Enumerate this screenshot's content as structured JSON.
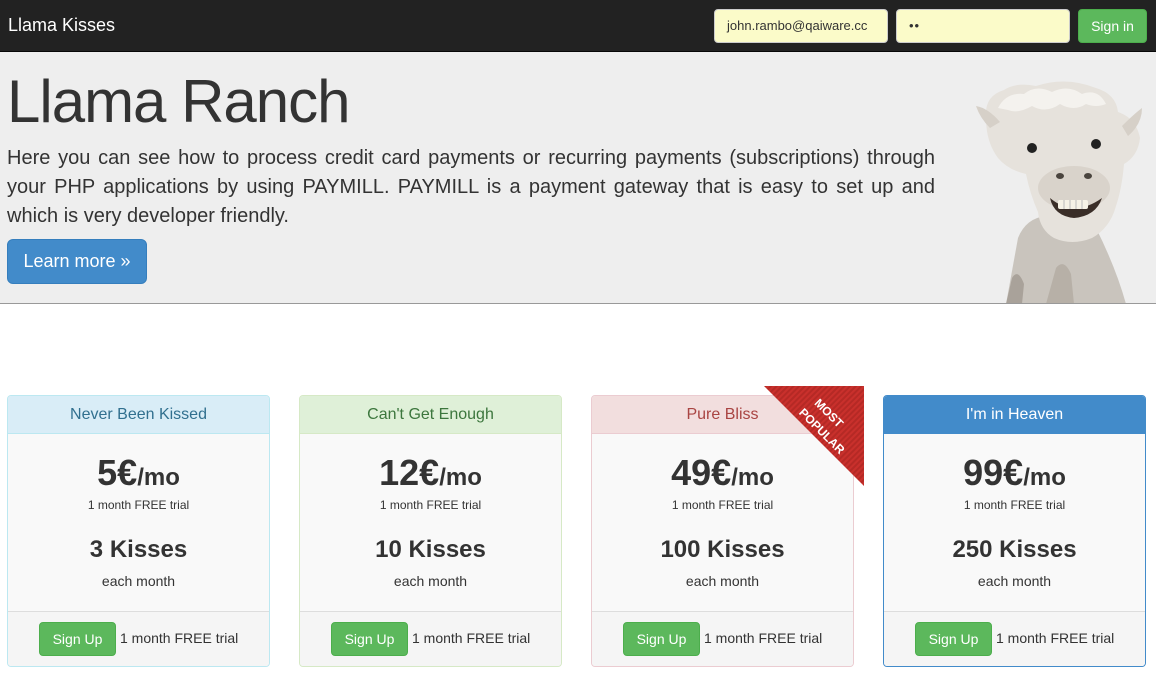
{
  "navbar": {
    "brand": "Llama Kisses",
    "email_value": "john.rambo@qaiware.cc",
    "password_value": "••",
    "signin_label": "Sign in"
  },
  "jumbotron": {
    "title": "Llama Ranch",
    "text": "Here you can see how to process credit card payments or recurring payments (subscriptions) through your PHP applications by using PAYMILL. PAYMILL is a payment gateway that is easy to set up and which is very developer friendly.",
    "button_label": "Learn more »"
  },
  "ribbon": {
    "line1": "MOST",
    "line2": "POPULAR",
    "color": "#c9302c"
  },
  "plans": [
    {
      "name": "Never Been Kissed",
      "price": "5€",
      "per": "/mo",
      "trial": "1 month FREE trial",
      "kisses": "3 Kisses",
      "each": "each month",
      "button": "Sign Up",
      "foot_trial": "1 month FREE trial"
    },
    {
      "name": "Can't Get Enough",
      "price": "12€",
      "per": "/mo",
      "trial": "1 month FREE trial",
      "kisses": "10 Kisses",
      "each": "each month",
      "button": "Sign Up",
      "foot_trial": "1 month FREE trial"
    },
    {
      "name": "Pure Bliss",
      "price": "49€",
      "per": "/mo",
      "trial": "1 month FREE trial",
      "kisses": "100 Kisses",
      "each": "each month",
      "button": "Sign Up",
      "foot_trial": "1 month FREE trial"
    },
    {
      "name": "I'm in Heaven",
      "price": "99€",
      "per": "/mo",
      "trial": "1 month FREE trial",
      "kisses": "250 Kisses",
      "each": "each month",
      "button": "Sign Up",
      "foot_trial": "1 month FREE trial"
    }
  ],
  "colors": {
    "navbar": "#222222",
    "primary": "#428bca",
    "success": "#5cb85c",
    "jumbotron": "#eeeeee"
  },
  "images": {
    "hero": "llama-photo"
  }
}
